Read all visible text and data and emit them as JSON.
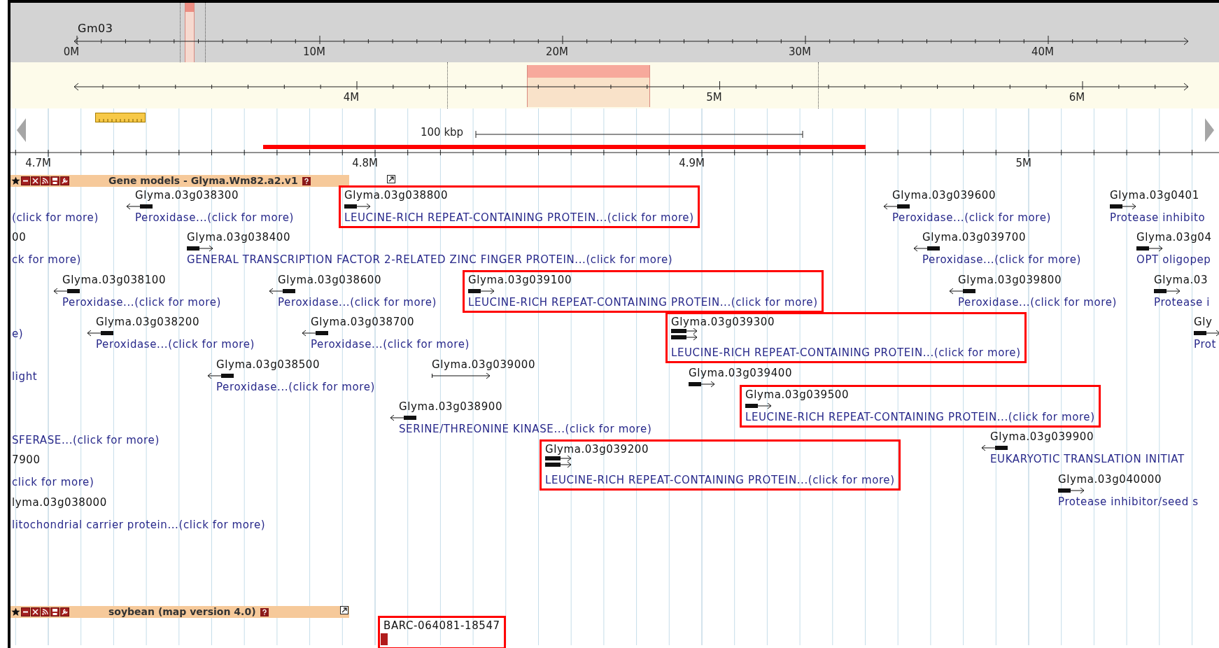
{
  "overview": {
    "chromosome": "Gm03",
    "ticks": [
      "0M",
      "10M",
      "20M",
      "30M",
      "40M"
    ]
  },
  "region": {
    "ticks": [
      "4M",
      "5M",
      "6M"
    ]
  },
  "scale_bar": {
    "label": "100 kbp"
  },
  "ruler": {
    "ticks": [
      "4.7M",
      "4.8M",
      "4.9M",
      "5M"
    ]
  },
  "tracks": [
    {
      "title": "Gene models - Glyma.Wm82.a2.v1",
      "features": [
        {
          "kind": "fragment",
          "description": "(click for more)",
          "highlighted": false
        },
        {
          "kind": "gene",
          "name": "Glyma.03g038300",
          "description": "Peroxidase...(click for more)",
          "reverse": true,
          "highlighted": false
        },
        {
          "kind": "gene",
          "name": "Glyma.03g038800",
          "description": "LEUCINE-RICH REPEAT-CONTAINING PROTEIN...(click for more)",
          "reverse": false,
          "highlighted": true
        },
        {
          "kind": "gene",
          "name": "Glyma.03g039600",
          "description": "Peroxidase...(click for more)",
          "reverse": true,
          "highlighted": false
        },
        {
          "kind": "gene",
          "name": "Glyma.03g0401",
          "description": "Protease inhibito",
          "reverse": false,
          "highlighted": false
        },
        {
          "kind": "fragment",
          "name": "00",
          "description": "ck for more)",
          "highlighted": false
        },
        {
          "kind": "gene",
          "name": "Glyma.03g038400",
          "description": "GENERAL TRANSCRIPTION FACTOR 2-RELATED ZINC FINGER PROTEIN...(click for more)",
          "reverse": false,
          "highlighted": false
        },
        {
          "kind": "gene",
          "name": "Glyma.03g039700",
          "description": "Peroxidase...(click for more)",
          "reverse": true,
          "highlighted": false
        },
        {
          "kind": "gene",
          "name": "Glyma.03g04",
          "description": "OPT oligopep",
          "reverse": false,
          "highlighted": false
        },
        {
          "kind": "gene",
          "name": "Glyma.03g038100",
          "description": "Peroxidase...(click for more)",
          "reverse": true,
          "highlighted": false
        },
        {
          "kind": "gene",
          "name": "Glyma.03g038600",
          "description": "Peroxidase...(click for more)",
          "reverse": true,
          "highlighted": false
        },
        {
          "kind": "gene",
          "name": "Glyma.03g039100",
          "description": "LEUCINE-RICH REPEAT-CONTAINING PROTEIN...(click for more)",
          "reverse": false,
          "highlighted": true
        },
        {
          "kind": "gene",
          "name": "Glyma.03g039800",
          "description": "Peroxidase...(click for more)",
          "reverse": true,
          "highlighted": false
        },
        {
          "kind": "gene",
          "name": "Glyma.03",
          "description": "Protease i",
          "reverse": false,
          "highlighted": false
        },
        {
          "kind": "fragment",
          "description": "e)",
          "highlighted": false
        },
        {
          "kind": "gene",
          "name": "Glyma.03g038200",
          "description": "Peroxidase...(click for more)",
          "reverse": true,
          "highlighted": false
        },
        {
          "kind": "gene",
          "name": "Glyma.03g038700",
          "description": "Peroxidase...(click for more)",
          "reverse": true,
          "highlighted": false
        },
        {
          "kind": "gene",
          "name": "Glyma.03g039300",
          "description": "LEUCINE-RICH REPEAT-CONTAINING PROTEIN...(click for more)",
          "reverse": false,
          "highlighted": true
        },
        {
          "kind": "gene",
          "name": "Gly",
          "description": "Prot",
          "reverse": false,
          "highlighted": false
        },
        {
          "kind": "fragment",
          "description": "light",
          "highlighted": false
        },
        {
          "kind": "gene",
          "name": "Glyma.03g038500",
          "description": "Peroxidase...(click for more)",
          "reverse": true,
          "highlighted": false
        },
        {
          "kind": "gene",
          "name": "Glyma.03g039000",
          "reverse": false,
          "highlighted": false
        },
        {
          "kind": "gene",
          "name": "Glyma.03g039400",
          "reverse": false,
          "highlighted": false
        },
        {
          "kind": "gene",
          "name": "Glyma.03g039500",
          "description": "LEUCINE-RICH REPEAT-CONTAINING PROTEIN...(click for more)",
          "reverse": false,
          "highlighted": true
        },
        {
          "kind": "gene",
          "name": "Glyma.03g038900",
          "description": "SERINE/THREONINE KINASE...(click for more)",
          "reverse": true,
          "highlighted": false
        },
        {
          "kind": "fragment",
          "description": "SFERASE...(click for more)",
          "highlighted": false
        },
        {
          "kind": "fragment",
          "name": "7900",
          "description": "click for more)",
          "highlighted": false
        },
        {
          "kind": "fragment",
          "name": "lyma.03g038000",
          "description": "litochondrial carrier protein...(click for more)",
          "highlighted": false
        },
        {
          "kind": "gene",
          "name": "Glyma.03g039200",
          "description": "LEUCINE-RICH REPEAT-CONTAINING PROTEIN...(click for more)",
          "reverse": false,
          "highlighted": true
        },
        {
          "kind": "gene",
          "name": "Glyma.03g039900",
          "description": "EUKARYOTIC TRANSLATION INITIAT",
          "reverse": true,
          "highlighted": false
        },
        {
          "kind": "gene",
          "name": "Glyma.03g040000",
          "description": "Protease inhibitor/seed s",
          "reverse": false,
          "highlighted": false
        }
      ]
    },
    {
      "title": "soybean (map version 4.0)",
      "features": [
        {
          "kind": "marker",
          "name": "BARC-064081-18547",
          "highlighted": true
        }
      ]
    }
  ]
}
